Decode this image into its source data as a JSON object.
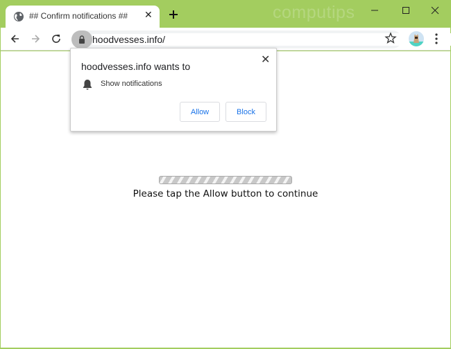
{
  "browser": {
    "tab": {
      "title": "## Confirm notifications ##",
      "icon": "globe-icon",
      "close_label": "✕"
    },
    "new_tab_icon": "plus-icon",
    "watermark": "computips",
    "window_controls": {
      "minimize": "minimize-icon",
      "maximize": "maximize-icon",
      "close": "close-icon"
    },
    "accent_color": "#a3cd5f"
  },
  "toolbar": {
    "back_icon": "arrow-left-icon",
    "forward_icon": "arrow-right-icon",
    "reload_icon": "reload-icon",
    "url": "hoodvesses.info/",
    "lock_icon": "lock-icon",
    "bookmark_icon": "star-icon",
    "menu_icon": "kebab-menu-icon"
  },
  "permission_prompt": {
    "title": "hoodvesses.info wants to",
    "permission": "Show notifications",
    "close_label": "✕",
    "allow_label": "Allow",
    "block_label": "Block",
    "button_color": "#1a73e8"
  },
  "page": {
    "progress_bar": "indeterminate",
    "message": "Please tap the Allow button to continue"
  }
}
